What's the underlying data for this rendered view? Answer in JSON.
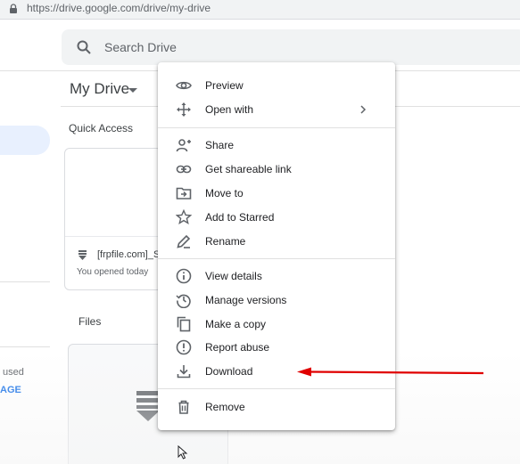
{
  "browser": {
    "url": "https://drive.google.com/drive/my-drive",
    "lock_icon": "lock-icon"
  },
  "header": {
    "search_placeholder": "Search Drive",
    "search_icon": "search-icon"
  },
  "sidebar": {
    "storage_used_text": "used",
    "storage_link_text": "AGE"
  },
  "main": {
    "title": "My Drive",
    "quick_access_label": "Quick Access",
    "quick_access_file": {
      "name": "[frpfile.com]_S",
      "activity": "You opened today",
      "icon": "file-archive-icon"
    },
    "files_label": "Files"
  },
  "context_menu": {
    "items": [
      {
        "label": "Preview",
        "icon": "eye-icon"
      },
      {
        "label": "Open with",
        "icon": "move-arrows-icon",
        "has_submenu": true
      },
      {
        "label": "Share",
        "icon": "person-add-icon"
      },
      {
        "label": "Get shareable link",
        "icon": "link-icon"
      },
      {
        "label": "Move to",
        "icon": "folder-move-icon"
      },
      {
        "label": "Add to Starred",
        "icon": "star-icon"
      },
      {
        "label": "Rename",
        "icon": "pencil-icon"
      },
      {
        "label": "View details",
        "icon": "info-icon"
      },
      {
        "label": "Manage versions",
        "icon": "history-icon"
      },
      {
        "label": "Make a copy",
        "icon": "copy-icon"
      },
      {
        "label": "Report abuse",
        "icon": "alert-icon"
      },
      {
        "label": "Download",
        "icon": "download-icon"
      },
      {
        "label": "Remove",
        "icon": "trash-icon"
      }
    ]
  },
  "colors": {
    "accent": "#1a73e8",
    "annotation_arrow": "#e00000",
    "active_nav": "#e8f0fe"
  }
}
